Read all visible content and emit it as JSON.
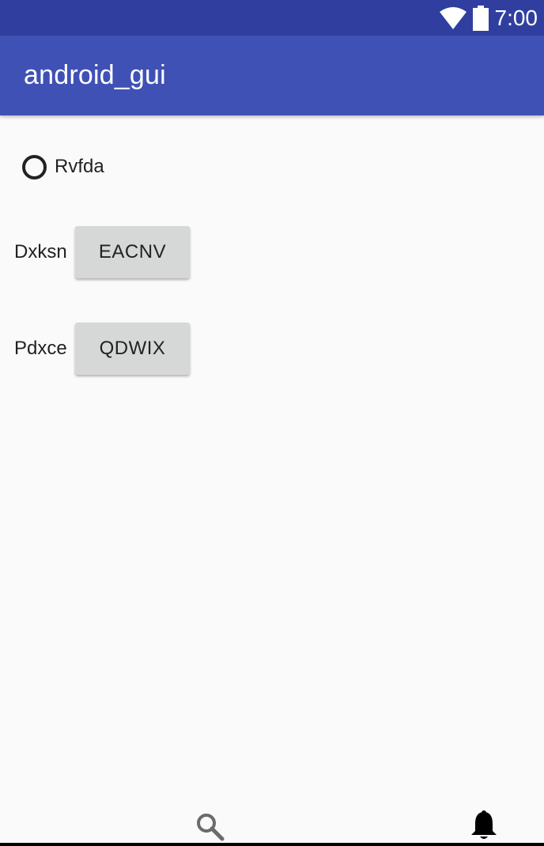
{
  "status_bar": {
    "time": "7:00",
    "icons": [
      "wifi-icon",
      "battery-icon"
    ],
    "background": "#303f9f"
  },
  "app_bar": {
    "title": "android_gui",
    "background": "#3f51b5"
  },
  "content": {
    "radio": {
      "label": "Rvfda",
      "checked": false
    },
    "rows": [
      {
        "label": "Dxksn",
        "button_label": "EACNV"
      },
      {
        "label": "Pdxce",
        "button_label": "QDWIX"
      }
    ]
  },
  "bottom_bar": {
    "icons": [
      "search-icon",
      "bell-icon"
    ]
  }
}
